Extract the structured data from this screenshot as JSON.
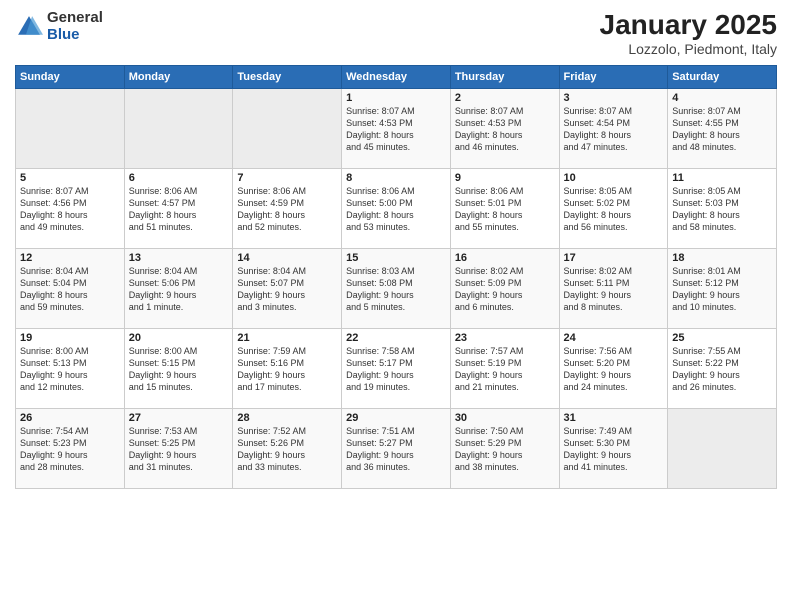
{
  "logo": {
    "general": "General",
    "blue": "Blue"
  },
  "calendar": {
    "title": "January 2025",
    "subtitle": "Lozzolo, Piedmont, Italy"
  },
  "headers": [
    "Sunday",
    "Monday",
    "Tuesday",
    "Wednesday",
    "Thursday",
    "Friday",
    "Saturday"
  ],
  "weeks": [
    [
      {
        "day": "",
        "info": ""
      },
      {
        "day": "",
        "info": ""
      },
      {
        "day": "",
        "info": ""
      },
      {
        "day": "1",
        "info": "Sunrise: 8:07 AM\nSunset: 4:53 PM\nDaylight: 8 hours\nand 45 minutes."
      },
      {
        "day": "2",
        "info": "Sunrise: 8:07 AM\nSunset: 4:53 PM\nDaylight: 8 hours\nand 46 minutes."
      },
      {
        "day": "3",
        "info": "Sunrise: 8:07 AM\nSunset: 4:54 PM\nDaylight: 8 hours\nand 47 minutes."
      },
      {
        "day": "4",
        "info": "Sunrise: 8:07 AM\nSunset: 4:55 PM\nDaylight: 8 hours\nand 48 minutes."
      }
    ],
    [
      {
        "day": "5",
        "info": "Sunrise: 8:07 AM\nSunset: 4:56 PM\nDaylight: 8 hours\nand 49 minutes."
      },
      {
        "day": "6",
        "info": "Sunrise: 8:06 AM\nSunset: 4:57 PM\nDaylight: 8 hours\nand 51 minutes."
      },
      {
        "day": "7",
        "info": "Sunrise: 8:06 AM\nSunset: 4:59 PM\nDaylight: 8 hours\nand 52 minutes."
      },
      {
        "day": "8",
        "info": "Sunrise: 8:06 AM\nSunset: 5:00 PM\nDaylight: 8 hours\nand 53 minutes."
      },
      {
        "day": "9",
        "info": "Sunrise: 8:06 AM\nSunset: 5:01 PM\nDaylight: 8 hours\nand 55 minutes."
      },
      {
        "day": "10",
        "info": "Sunrise: 8:05 AM\nSunset: 5:02 PM\nDaylight: 8 hours\nand 56 minutes."
      },
      {
        "day": "11",
        "info": "Sunrise: 8:05 AM\nSunset: 5:03 PM\nDaylight: 8 hours\nand 58 minutes."
      }
    ],
    [
      {
        "day": "12",
        "info": "Sunrise: 8:04 AM\nSunset: 5:04 PM\nDaylight: 8 hours\nand 59 minutes."
      },
      {
        "day": "13",
        "info": "Sunrise: 8:04 AM\nSunset: 5:06 PM\nDaylight: 9 hours\nand 1 minute."
      },
      {
        "day": "14",
        "info": "Sunrise: 8:04 AM\nSunset: 5:07 PM\nDaylight: 9 hours\nand 3 minutes."
      },
      {
        "day": "15",
        "info": "Sunrise: 8:03 AM\nSunset: 5:08 PM\nDaylight: 9 hours\nand 5 minutes."
      },
      {
        "day": "16",
        "info": "Sunrise: 8:02 AM\nSunset: 5:09 PM\nDaylight: 9 hours\nand 6 minutes."
      },
      {
        "day": "17",
        "info": "Sunrise: 8:02 AM\nSunset: 5:11 PM\nDaylight: 9 hours\nand 8 minutes."
      },
      {
        "day": "18",
        "info": "Sunrise: 8:01 AM\nSunset: 5:12 PM\nDaylight: 9 hours\nand 10 minutes."
      }
    ],
    [
      {
        "day": "19",
        "info": "Sunrise: 8:00 AM\nSunset: 5:13 PM\nDaylight: 9 hours\nand 12 minutes."
      },
      {
        "day": "20",
        "info": "Sunrise: 8:00 AM\nSunset: 5:15 PM\nDaylight: 9 hours\nand 15 minutes."
      },
      {
        "day": "21",
        "info": "Sunrise: 7:59 AM\nSunset: 5:16 PM\nDaylight: 9 hours\nand 17 minutes."
      },
      {
        "day": "22",
        "info": "Sunrise: 7:58 AM\nSunset: 5:17 PM\nDaylight: 9 hours\nand 19 minutes."
      },
      {
        "day": "23",
        "info": "Sunrise: 7:57 AM\nSunset: 5:19 PM\nDaylight: 9 hours\nand 21 minutes."
      },
      {
        "day": "24",
        "info": "Sunrise: 7:56 AM\nSunset: 5:20 PM\nDaylight: 9 hours\nand 24 minutes."
      },
      {
        "day": "25",
        "info": "Sunrise: 7:55 AM\nSunset: 5:22 PM\nDaylight: 9 hours\nand 26 minutes."
      }
    ],
    [
      {
        "day": "26",
        "info": "Sunrise: 7:54 AM\nSunset: 5:23 PM\nDaylight: 9 hours\nand 28 minutes."
      },
      {
        "day": "27",
        "info": "Sunrise: 7:53 AM\nSunset: 5:25 PM\nDaylight: 9 hours\nand 31 minutes."
      },
      {
        "day": "28",
        "info": "Sunrise: 7:52 AM\nSunset: 5:26 PM\nDaylight: 9 hours\nand 33 minutes."
      },
      {
        "day": "29",
        "info": "Sunrise: 7:51 AM\nSunset: 5:27 PM\nDaylight: 9 hours\nand 36 minutes."
      },
      {
        "day": "30",
        "info": "Sunrise: 7:50 AM\nSunset: 5:29 PM\nDaylight: 9 hours\nand 38 minutes."
      },
      {
        "day": "31",
        "info": "Sunrise: 7:49 AM\nSunset: 5:30 PM\nDaylight: 9 hours\nand 41 minutes."
      },
      {
        "day": "",
        "info": ""
      }
    ]
  ]
}
